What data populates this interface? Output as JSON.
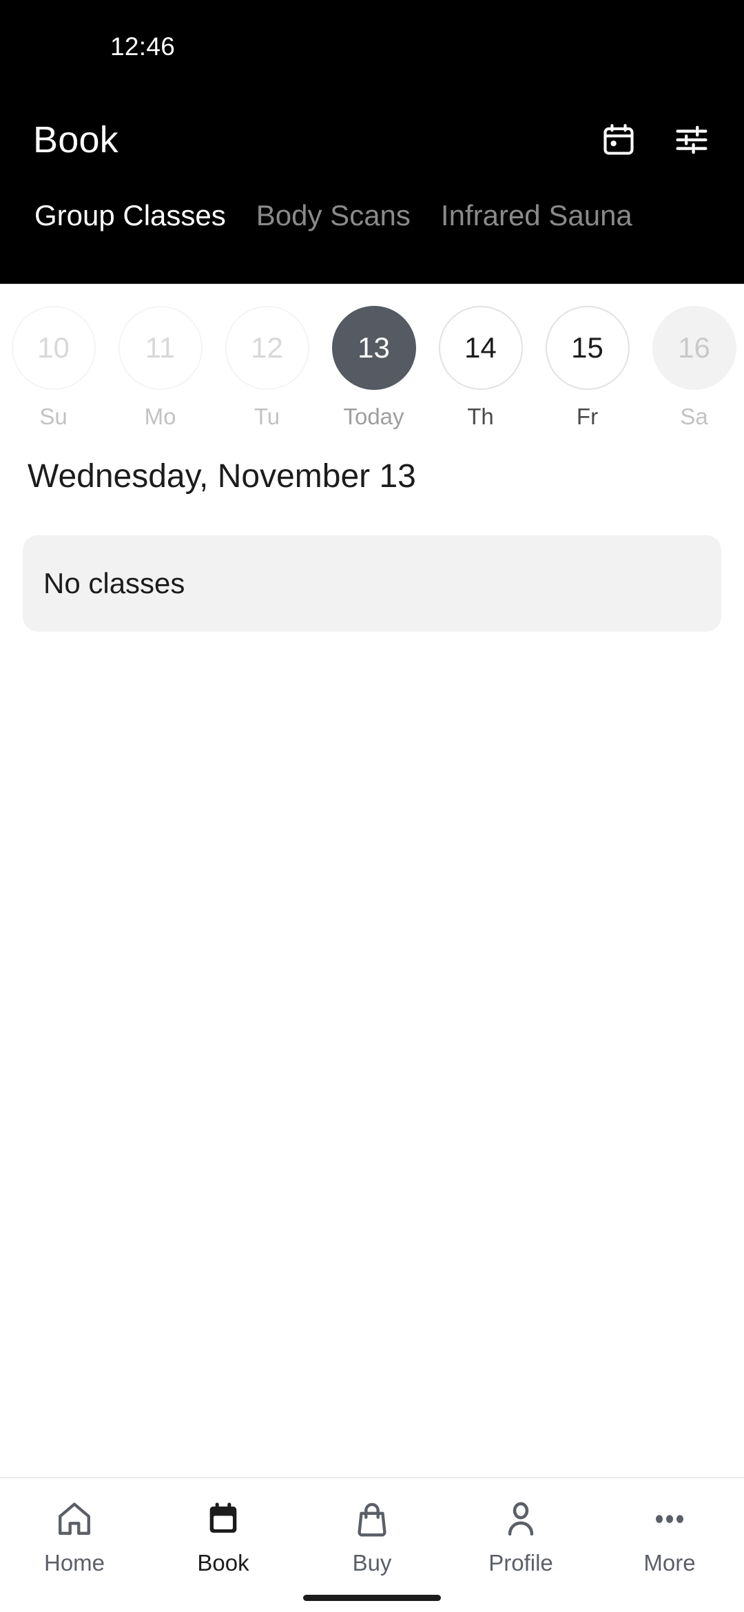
{
  "status_bar": {
    "time": "12:46"
  },
  "app_bar": {
    "title": "Book",
    "actions": [
      {
        "name": "calendar-icon",
        "label": "Calendar"
      },
      {
        "name": "filter-icon",
        "label": "Filters"
      }
    ]
  },
  "tabs": [
    {
      "label": "Group Classes",
      "active": true
    },
    {
      "label": "Body Scans",
      "active": false
    },
    {
      "label": "Infrared Sauna",
      "active": false
    }
  ],
  "date_strip": [
    {
      "day_number": "10",
      "weekday": "Su",
      "state": "past"
    },
    {
      "day_number": "11",
      "weekday": "Mo",
      "state": "past"
    },
    {
      "day_number": "12",
      "weekday": "Tu",
      "state": "past"
    },
    {
      "day_number": "13",
      "weekday": "Today",
      "state": "selected"
    },
    {
      "day_number": "14",
      "weekday": "Th",
      "state": "available"
    },
    {
      "day_number": "15",
      "weekday": "Fr",
      "state": "available"
    },
    {
      "day_number": "16",
      "weekday": "Sa",
      "state": "muted"
    }
  ],
  "main": {
    "day_heading": "Wednesday, November 13",
    "empty_state_text": "No classes"
  },
  "bottom_nav": [
    {
      "label": "Home",
      "icon": "home-icon",
      "active": false
    },
    {
      "label": "Book",
      "icon": "calendar-filled-icon",
      "active": true
    },
    {
      "label": "Buy",
      "icon": "shopping-bag-icon",
      "active": false
    },
    {
      "label": "Profile",
      "icon": "person-icon",
      "active": false
    },
    {
      "label": "More",
      "icon": "more-dots-icon",
      "active": false
    }
  ],
  "colors": {
    "header_background": "#000000",
    "selected_date": "#555a63",
    "card_background": "#f2f2f2",
    "active_tab_text": "#ffffff",
    "inactive_tab_text": "#8a8a8a",
    "nav_label": "#5b5f66"
  }
}
